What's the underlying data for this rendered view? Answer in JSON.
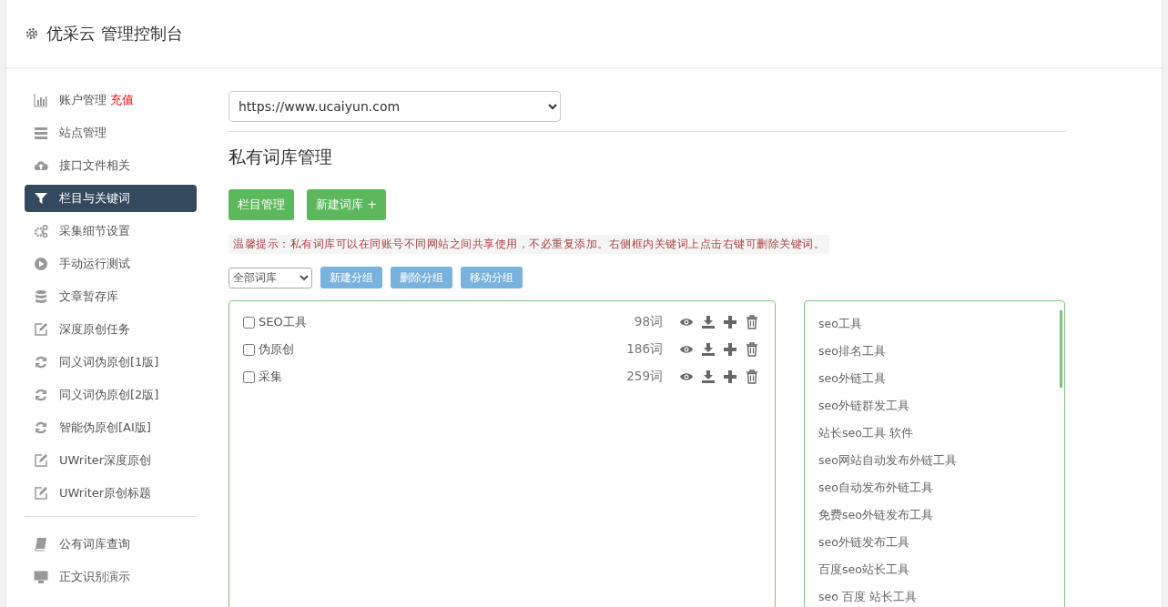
{
  "header": {
    "title": "优采云 管理控制台"
  },
  "sidebar": {
    "items": [
      {
        "kind": "chart",
        "label": "账户管理",
        "badge": "充值",
        "selected": false
      },
      {
        "kind": "server",
        "label": "站点管理",
        "selected": false
      },
      {
        "kind": "cloud",
        "label": "接口文件相关",
        "selected": false
      },
      {
        "kind": "filter",
        "label": "栏目与关键词",
        "selected": true
      },
      {
        "kind": "gears",
        "label": "采集细节设置",
        "selected": false
      },
      {
        "kind": "play",
        "label": "手动运行测试",
        "selected": false
      },
      {
        "kind": "database",
        "label": "文章暂存库",
        "selected": false
      },
      {
        "kind": "edit",
        "label": "深度原创任务",
        "selected": false
      },
      {
        "kind": "refresh",
        "label": "同义词伪原创[1版]",
        "selected": false
      },
      {
        "kind": "refresh",
        "label": "同义词伪原创[2版]",
        "selected": false
      },
      {
        "kind": "refresh",
        "label": "智能伪原创[AI版]",
        "selected": false
      },
      {
        "kind": "edit",
        "label": "UWriter深度原创",
        "selected": false
      },
      {
        "kind": "edit",
        "label": "UWriter原创标题",
        "selected": false
      },
      {
        "kind": "divider"
      },
      {
        "kind": "book",
        "label": "公有词库查询",
        "selected": false
      },
      {
        "kind": "monitor",
        "label": "正文识别演示",
        "selected": false
      }
    ]
  },
  "site_select": {
    "value": "https://www.ucaiyun.com"
  },
  "page_title": "私有词库管理",
  "top_buttons": [
    "栏目管理",
    "新建词库 +"
  ],
  "tip": "温馨提示：私有词库可以在同账号不同网站之间共享使用，不必重复添加。右侧框内关键词上点击右键可删除关键词。",
  "group_select": {
    "value": "全部词库"
  },
  "group_buttons": [
    "新建分组",
    "删除分组",
    "移动分组"
  ],
  "libraries": [
    {
      "name": "SEO工具",
      "count": "98词",
      "checked": false
    },
    {
      "name": "伪原创",
      "count": "186词",
      "checked": false
    },
    {
      "name": "采集",
      "count": "259词",
      "checked": false
    }
  ],
  "keywords": [
    "seo工具",
    "seo排名工具",
    "seo外链工具",
    "seo外链群发工具",
    "站长seo工具 软件",
    "seo网站自动发布外链工具",
    "seo自动发布外链工具",
    "免费seo外链发布工具",
    "seo外链发布工具",
    "百度seo站长工具",
    "seo 百度 站长工具"
  ]
}
